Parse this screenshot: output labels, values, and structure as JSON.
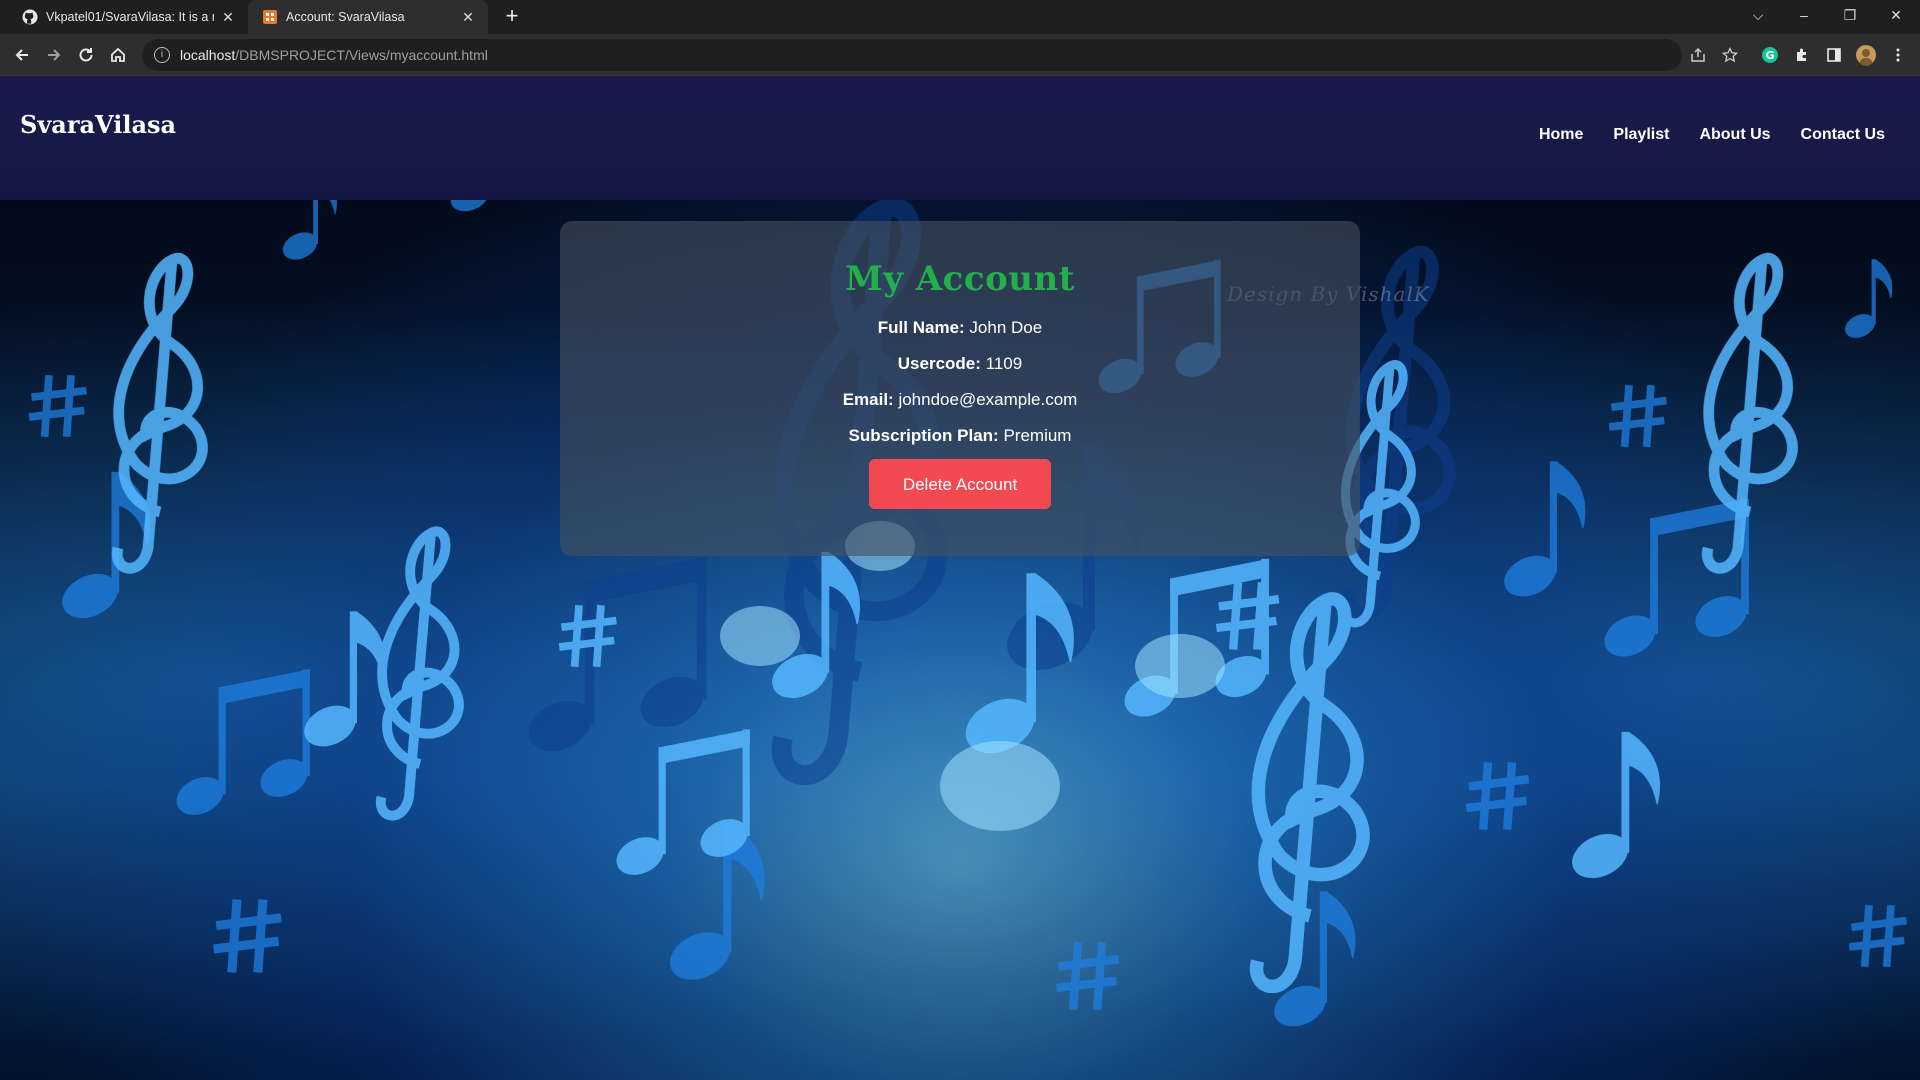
{
  "browser": {
    "tabs": [
      {
        "title": "Vkpatel01/SvaraVilasa: It is a mu",
        "icon": "github-icon",
        "active": false
      },
      {
        "title": "Account: SvaraVilasa",
        "icon": "site-favicon-icon",
        "active": true
      }
    ],
    "address": {
      "host": "localhost",
      "path": "/DBMSPROJECT/Views/myaccount.html"
    }
  },
  "navbar": {
    "brand": "SvaraVilasa",
    "links": [
      "Home",
      "Playlist",
      "About Us",
      "Contact Us"
    ]
  },
  "account": {
    "title": "My Account",
    "watermark": "Design By VishalK",
    "fields": [
      {
        "label": "Full Name:",
        "value": "John Doe"
      },
      {
        "label": "Usercode:",
        "value": "1109"
      },
      {
        "label": "Email:",
        "value": "johndoe@example.com"
      },
      {
        "label": "Subscription Plan:",
        "value": "Premium"
      }
    ],
    "delete_label": "Delete Account"
  },
  "colors": {
    "navbar": "#191a4b",
    "title_green": "#21b14b",
    "delete_red": "#f24a50"
  }
}
